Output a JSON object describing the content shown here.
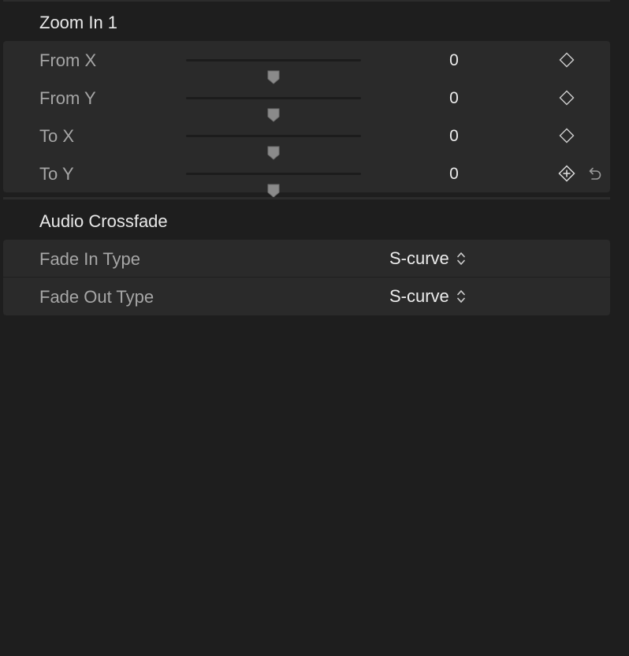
{
  "zoom_section": {
    "title": "Zoom In 1",
    "rows": [
      {
        "label": "From X",
        "value": "0",
        "slider_fraction": 0.5
      },
      {
        "label": "From Y",
        "value": "0",
        "slider_fraction": 0.5
      },
      {
        "label": "To X",
        "value": "0",
        "slider_fraction": 0.5
      },
      {
        "label": "To Y",
        "value": "0",
        "slider_fraction": 0.5
      }
    ]
  },
  "audio_section": {
    "title": "Audio Crossfade",
    "rows": [
      {
        "label": "Fade In Type",
        "value": "S-curve"
      },
      {
        "label": "Fade Out Type",
        "value": "S-curve"
      }
    ]
  },
  "icons": {
    "keyframe": "diamond-icon",
    "keyframe_add": "add-keyframe-icon",
    "reset": "reset-arrow-icon",
    "popup": "up-down-chevron-icon"
  }
}
